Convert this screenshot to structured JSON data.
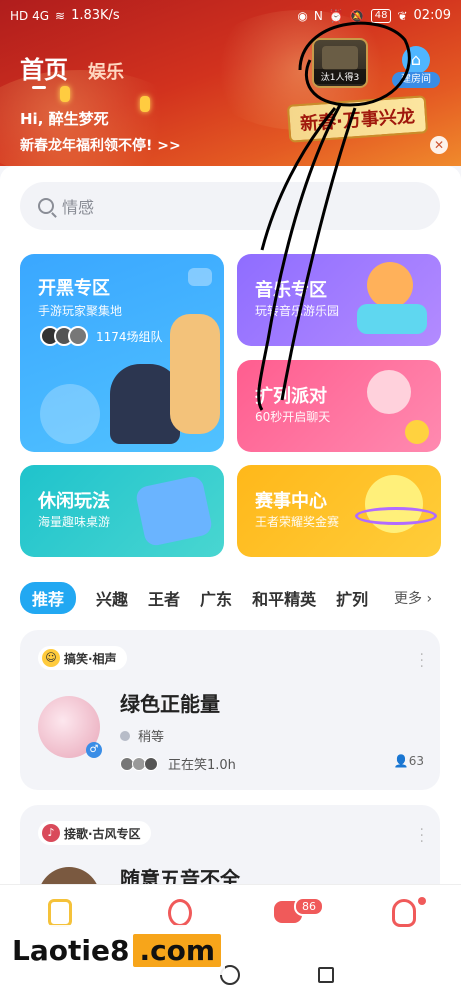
{
  "status_bar": {
    "network": "HD 4G",
    "speed": "1.83K/s",
    "battery": "48",
    "time": "02:09"
  },
  "header": {
    "tab_home": "首页",
    "tab_entertainment": "娱乐",
    "greeting": "Hi, 醉生梦死",
    "promo": "新春龙年福利领不停! >>",
    "game_badge_label": "汰1人得3",
    "create_room_label": "建房间",
    "festival_sign": "新春·万事兴龙"
  },
  "search": {
    "placeholder": "情感"
  },
  "zones": {
    "kaihei": {
      "title": "开黑专区",
      "subtitle": "手游玩家聚集地",
      "count": "1174场组队"
    },
    "music": {
      "title": "音乐专区",
      "subtitle": "玩转音乐游乐园"
    },
    "party": {
      "title": "扩列派对",
      "subtitle": "60秒开启聊天"
    },
    "casual": {
      "title": "休闲玩法",
      "subtitle": "海量趣味桌游"
    },
    "match": {
      "title": "赛事中心",
      "subtitle": "王者荣耀奖金赛"
    }
  },
  "categories": [
    "推荐",
    "兴趣",
    "王者",
    "广东",
    "和平精英",
    "扩列"
  ],
  "more_label": "更多",
  "rooms": [
    {
      "tag": "搞笑·相声",
      "title": "绿色正能量",
      "host": "稍等",
      "status": "正在笑1.0h",
      "online": "63"
    },
    {
      "tag": "接歌·古风专区",
      "title": "随意五音不全"
    }
  ],
  "bottom_nav": {
    "messages_badge": "86"
  },
  "watermark": {
    "text1": "Laotie8",
    "text2": ".com"
  },
  "colors": {
    "accent": "#22a8f2",
    "banner_red": "#d2321e",
    "badge_red": "#f05a5a"
  }
}
